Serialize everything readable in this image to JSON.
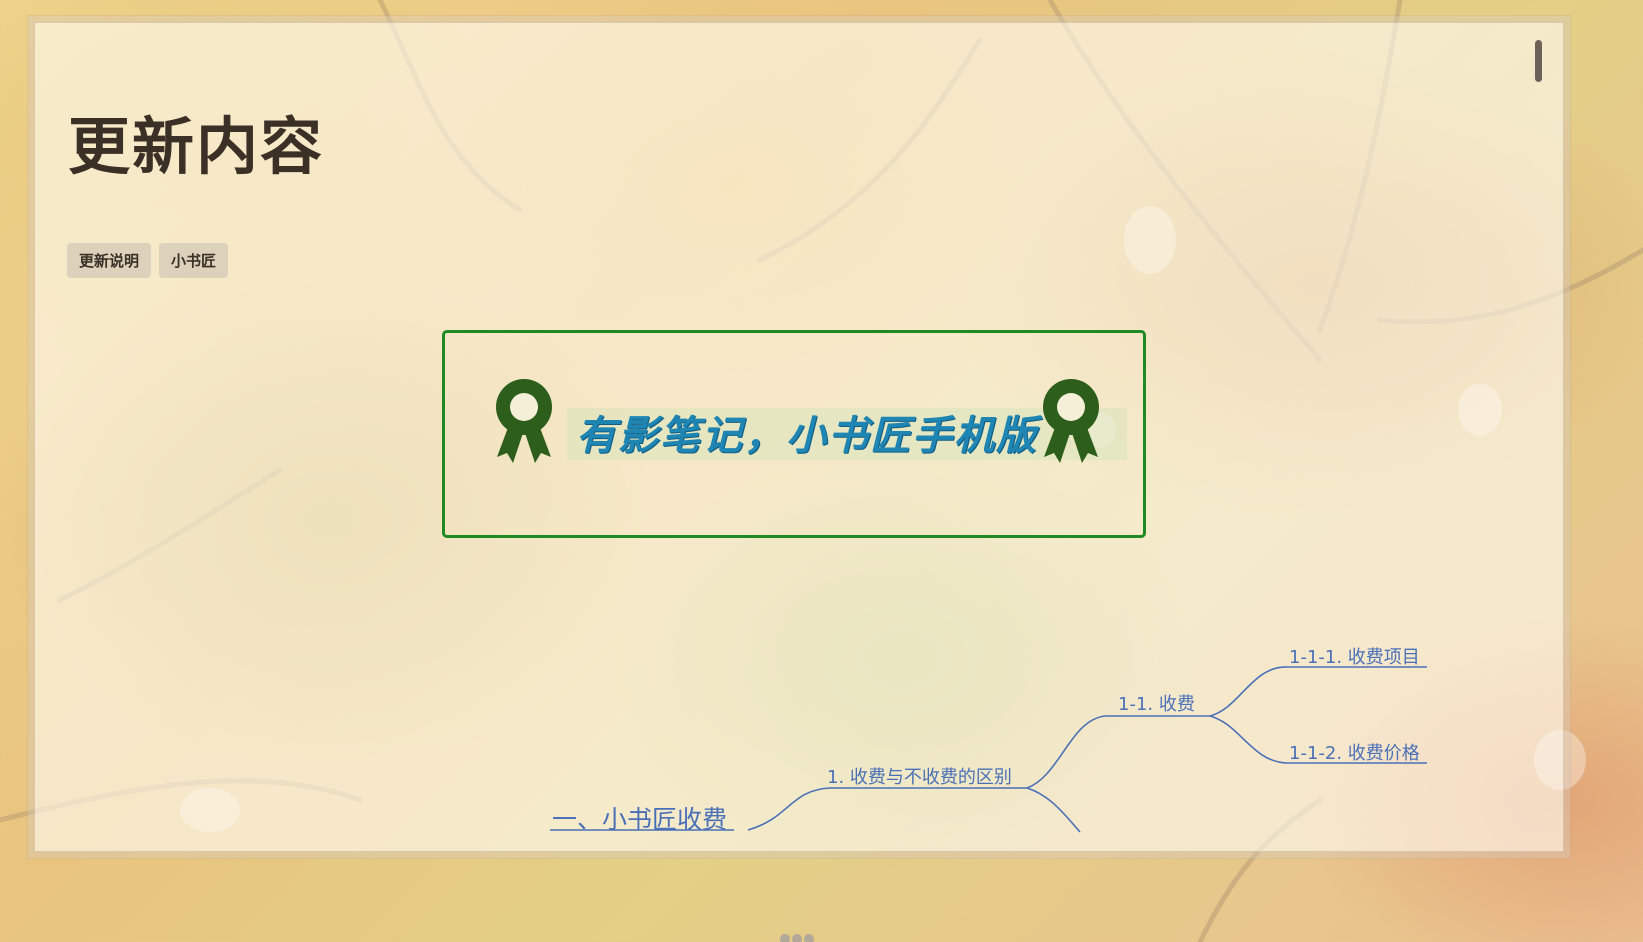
{
  "page": {
    "title": "更新内容",
    "tags": [
      "更新说明",
      "小书匠"
    ]
  },
  "banner": {
    "text": "有影笔记，小书匠手机版",
    "left_icon": "award-ribbon-icon",
    "right_icon": "award-ribbon-icon",
    "border_color": "#1d8a24",
    "text_color": "#1f86b4"
  },
  "mindmap": {
    "root": "一、小书匠收费",
    "level1": "1. 收费与不收费的区别",
    "level2": "1-1. 收费",
    "level3": [
      "1-1-1. 收费项目",
      "1-1-2. 收费价格"
    ],
    "line_color": "#4a70b8"
  },
  "colors": {
    "title": "#3a3026",
    "page_bg": "#fffcf4"
  }
}
